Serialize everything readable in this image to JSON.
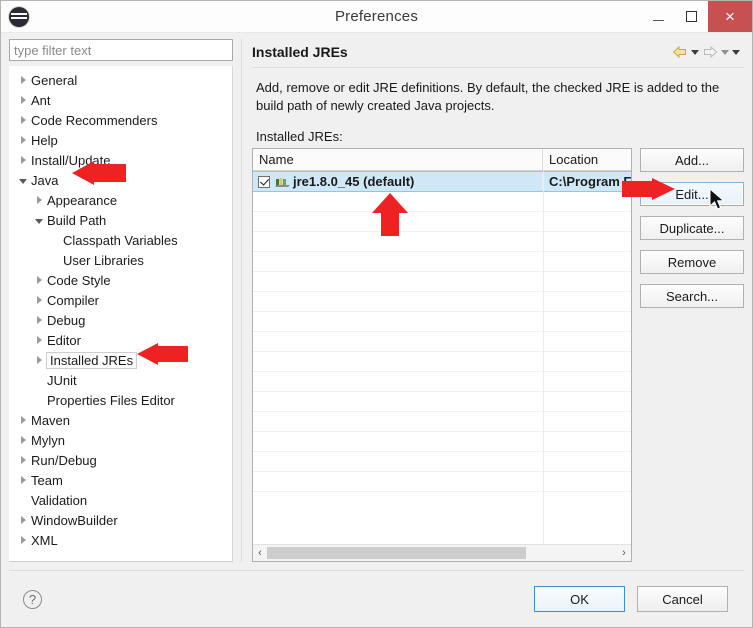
{
  "window": {
    "title": "Preferences",
    "app_icon": "eclipse-globe-icon",
    "minimize_label": "",
    "maximize_label": "",
    "close_label": "×"
  },
  "sidebar": {
    "filter": {
      "value": "",
      "placeholder": "type filter text"
    },
    "items": [
      {
        "label": "General",
        "indent": 0,
        "state": "collapsed"
      },
      {
        "label": "Ant",
        "indent": 0,
        "state": "collapsed"
      },
      {
        "label": "Code Recommenders",
        "indent": 0,
        "state": "collapsed"
      },
      {
        "label": "Help",
        "indent": 0,
        "state": "collapsed"
      },
      {
        "label": "Install/Update",
        "indent": 0,
        "state": "collapsed"
      },
      {
        "label": "Java",
        "indent": 0,
        "state": "expanded"
      },
      {
        "label": "Appearance",
        "indent": 1,
        "state": "collapsed"
      },
      {
        "label": "Build Path",
        "indent": 1,
        "state": "expanded"
      },
      {
        "label": "Classpath Variables",
        "indent": 2,
        "state": "leaf"
      },
      {
        "label": "User Libraries",
        "indent": 2,
        "state": "leaf"
      },
      {
        "label": "Code Style",
        "indent": 1,
        "state": "collapsed"
      },
      {
        "label": "Compiler",
        "indent": 1,
        "state": "collapsed"
      },
      {
        "label": "Debug",
        "indent": 1,
        "state": "collapsed"
      },
      {
        "label": "Editor",
        "indent": 1,
        "state": "collapsed"
      },
      {
        "label": "Installed JREs",
        "indent": 1,
        "state": "collapsed",
        "selected": true
      },
      {
        "label": "JUnit",
        "indent": 1,
        "state": "leaf"
      },
      {
        "label": "Properties Files Editor",
        "indent": 1,
        "state": "leaf"
      },
      {
        "label": "Maven",
        "indent": 0,
        "state": "collapsed"
      },
      {
        "label": "Mylyn",
        "indent": 0,
        "state": "collapsed"
      },
      {
        "label": "Run/Debug",
        "indent": 0,
        "state": "collapsed"
      },
      {
        "label": "Team",
        "indent": 0,
        "state": "collapsed"
      },
      {
        "label": "Validation",
        "indent": 0,
        "state": "leaf"
      },
      {
        "label": "WindowBuilder",
        "indent": 0,
        "state": "collapsed"
      },
      {
        "label": "XML",
        "indent": 0,
        "state": "collapsed"
      }
    ]
  },
  "page": {
    "title": "Installed JREs",
    "description": "Add, remove or edit JRE definitions. By default, the checked JRE is added to the build path of newly created Java projects.",
    "list_label": "Installed JREs:",
    "nav": {
      "back_icon": "back-arrow-icon",
      "back_menu_icon": "chevron-down-icon",
      "forward_icon": "forward-arrow-icon",
      "forward_menu_icon": "chevron-down-icon",
      "more_icon": "chevron-down-icon"
    }
  },
  "table": {
    "columns": [
      "Name",
      "Location"
    ],
    "rows": [
      {
        "checked": true,
        "icon": "jre-library-icon",
        "name": "jre1.8.0_45 (default)",
        "location": "C:\\Program Fil",
        "selected": true
      }
    ],
    "empty_row_count": 15,
    "scrollbar": {
      "left_arrow": "‹",
      "right_arrow": "›",
      "thumb_percent": 74
    }
  },
  "buttons": {
    "side": [
      {
        "label": "Add...",
        "focused": false
      },
      {
        "label": "Edit...",
        "focused": true
      },
      {
        "label": "Duplicate...",
        "focused": false
      },
      {
        "label": "Remove",
        "focused": false
      },
      {
        "label": "Search...",
        "focused": false
      }
    ]
  },
  "footer": {
    "help_icon": "help-question-icon",
    "ok_label": "OK",
    "cancel_label": "Cancel"
  },
  "annotations": [
    {
      "name": "arrow-pointing-java",
      "direction": "left"
    },
    {
      "name": "arrow-pointing-installed-jres",
      "direction": "left"
    },
    {
      "name": "arrow-pointing-jre-row",
      "direction": "up"
    },
    {
      "name": "arrow-pointing-edit-button",
      "direction": "right"
    }
  ],
  "colors": {
    "accent": "#3c8fd0",
    "selection": "#cfe8f7",
    "annotation": "#ee2222",
    "close_button": "#c75050"
  }
}
